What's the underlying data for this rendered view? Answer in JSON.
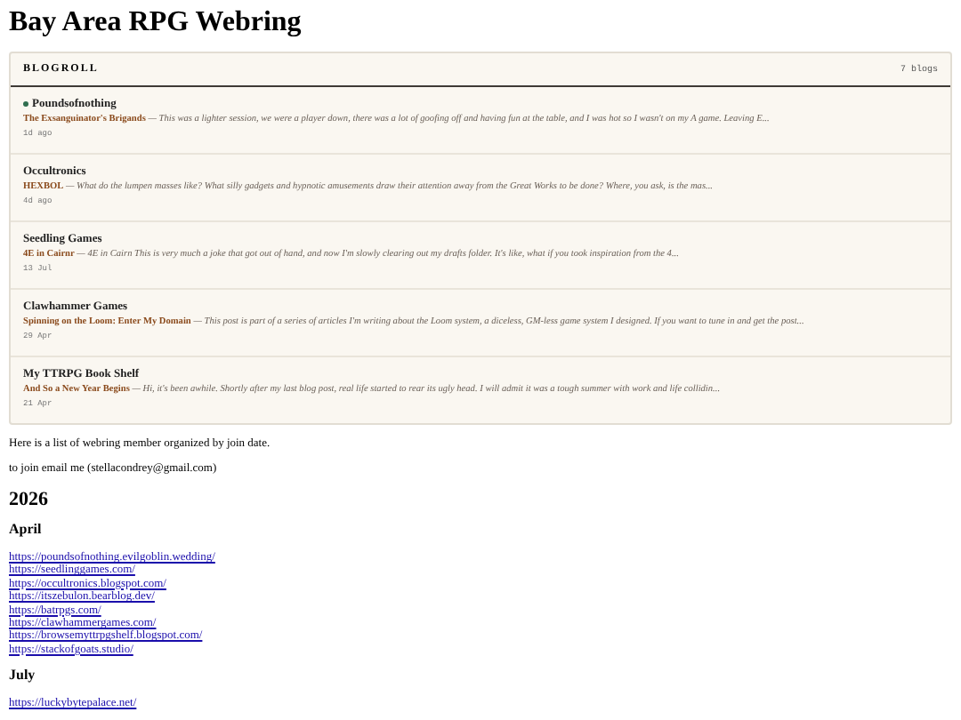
{
  "title": "Bay Area RPG Webring",
  "blogroll": {
    "heading": "BLOGROLL",
    "count": "7 blogs",
    "entries": [
      {
        "blog": "Poundsofnothing",
        "new": true,
        "post": "The Exsanguinator's Brigands",
        "excerpt": "— This was a lighter session, we were a player down, there was a lot of goofing off and having fun at the table, and I was hot so I wasn't on my A game. Leaving E...",
        "age": "1d ago"
      },
      {
        "blog": "Occultronics",
        "new": false,
        "post": "HEXBOL",
        "excerpt": "— What do the lumpen masses like? What silly gadgets and hypnotic amusements draw their attention away from the Great Works to be done? Where, you ask, is the mas...",
        "age": "4d ago"
      },
      {
        "blog": "Seedling Games",
        "new": false,
        "post": "4E in Cairnr",
        "excerpt": "— 4E in Cairn This is very much a joke that got out of hand, and now I'm slowly clearing out my drafts folder. It's like, what if you took inspiration from the 4...",
        "age": "13 Jul"
      },
      {
        "blog": "Clawhammer Games",
        "new": false,
        "post": "Spinning on the Loom: Enter My Domain",
        "excerpt": "— This post is part of a series of articles I'm writing about the Loom system, a diceless, GM-less game system I designed. If you want to tune in and get the post...",
        "age": "29 Apr"
      },
      {
        "blog": "My TTRPG Book Shelf",
        "new": false,
        "post": "And So a New Year Begins",
        "excerpt": "— Hi, it's been awhile.  Shortly after my last blog post, real life started to rear its ugly head. I will admit it was a tough summer with work and life collidin...",
        "age": "21 Apr"
      }
    ]
  },
  "intro": "Here is a list of webring member organized by join date.",
  "join": "to join email me (stellacondrey@gmail.com)",
  "years": [
    {
      "year": "2026",
      "months": [
        {
          "month": "April",
          "links": [
            "https://poundsofnothing.evilgoblin.wedding/",
            "https://seedlinggames.com/",
            "https://occultronics.blogspot.com/",
            "https://itszebulon.bearblog.dev/",
            "https://batrpgs.com/",
            "https://clawhammergames.com/",
            "https://browsemyttrpgshelf.blogspot.com/",
            "https://stackofgoats.studio/"
          ]
        },
        {
          "month": "July",
          "links": [
            "https://luckybytepalace.net/"
          ]
        }
      ]
    }
  ]
}
